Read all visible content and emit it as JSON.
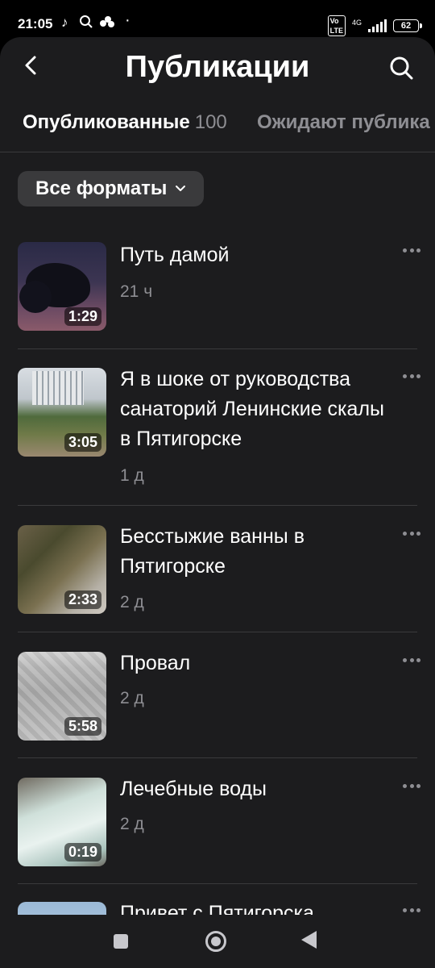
{
  "status_bar": {
    "time": "21:05",
    "network": "4G",
    "battery": "62"
  },
  "header": {
    "title": "Публикации"
  },
  "tabs": [
    {
      "label": "Опубликованные",
      "count": "100"
    },
    {
      "label": "Ожидают публика"
    }
  ],
  "filter": {
    "label": "Все форматы"
  },
  "posts": [
    {
      "title": "Путь дамой",
      "time": "21 ч",
      "duration": "1:29"
    },
    {
      "title": "Я в шоке от руководства санаторий Ленинские скалы в Пятигорске",
      "time": "1 д",
      "duration": "3:05"
    },
    {
      "title": "Бесстыжие ванны в Пятигорске",
      "time": "2 д",
      "duration": "2:33"
    },
    {
      "title": "Провал",
      "time": "2 д",
      "duration": "5:58"
    },
    {
      "title": "Лечебные воды",
      "time": "2 д",
      "duration": "0:19"
    },
    {
      "title": "Привет с Пятигорска"
    }
  ]
}
